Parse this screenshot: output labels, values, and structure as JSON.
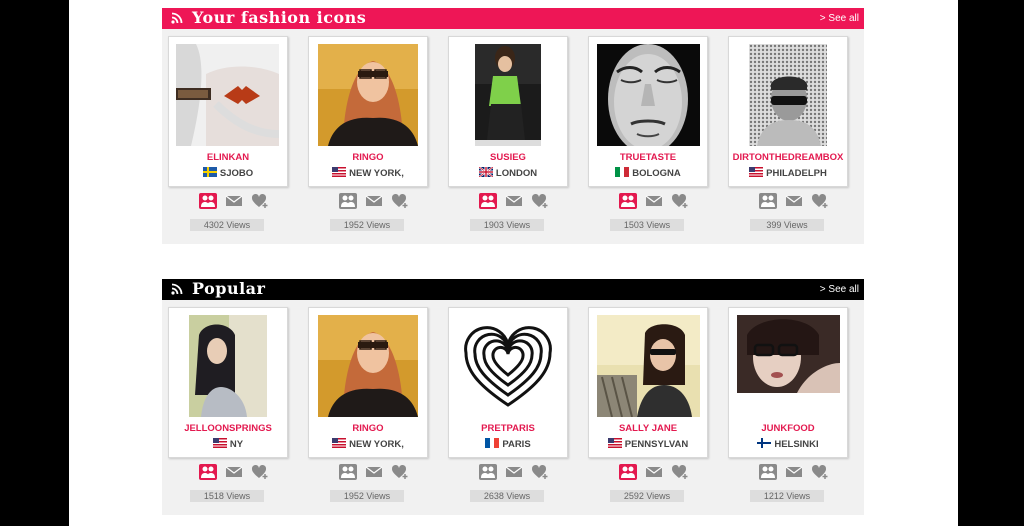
{
  "sections": [
    {
      "title": "Your fashion icons",
      "see_all": "> See all",
      "cards": [
        {
          "username": "ELINKAN",
          "location": "SJOBO",
          "flag": "sweden",
          "views": "4302 Views",
          "friend_active": true
        },
        {
          "username": "RINGO",
          "location": "NEW YORK,",
          "flag": "usa",
          "views": "1952 Views",
          "friend_active": false
        },
        {
          "username": "SUSIEG",
          "location": "LONDON",
          "flag": "uk",
          "views": "1903 Views",
          "friend_active": true
        },
        {
          "username": "TRUETASTE",
          "location": "BOLOGNA",
          "flag": "italy",
          "views": "1503 Views",
          "friend_active": true
        },
        {
          "username": "DIRTONTHEDREAMBOX",
          "location": "PHILADELPH",
          "flag": "usa",
          "views": "399 Views",
          "friend_active": false
        }
      ]
    },
    {
      "title": "Popular",
      "see_all": "> See all",
      "cards": [
        {
          "username": "JELLOONSPRINGS",
          "location": "NY",
          "flag": "usa",
          "views": "1518 Views",
          "friend_active": true
        },
        {
          "username": "RINGO",
          "location": "NEW YORK,",
          "flag": "usa",
          "views": "1952 Views",
          "friend_active": false
        },
        {
          "username": "PRETPARIS",
          "location": "PARIS",
          "flag": "france",
          "views": "2638 Views",
          "friend_active": false
        },
        {
          "username": "SALLY JANE",
          "location": "PENNSYLVAN",
          "flag": "usa",
          "views": "2592 Views",
          "friend_active": true
        },
        {
          "username": "JUNKFOOD",
          "location": "HELSINKI",
          "flag": "finland",
          "views": "1212 Views",
          "friend_active": false
        }
      ]
    }
  ],
  "colors": {
    "accent": "#ee1656",
    "action_active": "#e3194f",
    "action_inactive": "#8a8a8a"
  },
  "icons": {
    "feed": "rss-icon",
    "friend": "friends-icon",
    "message": "envelope-icon",
    "favorite": "heart-plus-icon"
  }
}
